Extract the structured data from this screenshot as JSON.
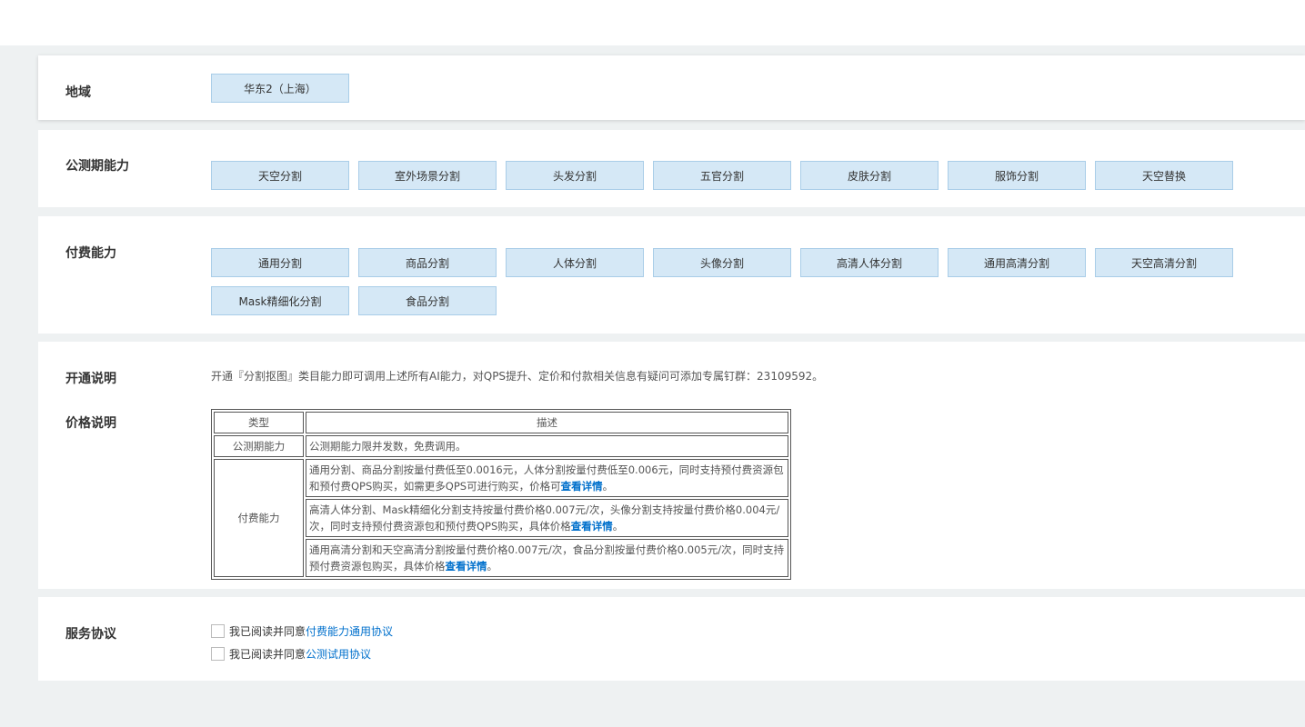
{
  "region": {
    "label": "地域",
    "options": [
      "华东2（上海）"
    ]
  },
  "beta": {
    "label": "公测期能力",
    "options": [
      "天空分割",
      "室外场景分割",
      "头发分割",
      "五官分割",
      "皮肤分割",
      "服饰分割",
      "天空替换"
    ]
  },
  "paid": {
    "label": "付费能力",
    "options": [
      "通用分割",
      "商品分割",
      "人体分割",
      "头像分割",
      "高清人体分割",
      "通用高清分割",
      "天空高清分割",
      "Mask精细化分割",
      "食品分割"
    ]
  },
  "activation": {
    "label": "开通说明",
    "text": "开通『分割抠图』类目能力即可调用上述所有AI能力，对QPS提升、定价和付款相关信息有疑问可添加专属钉群：23109592。"
  },
  "pricing": {
    "label": "价格说明",
    "headers": [
      "类型",
      "描述"
    ],
    "beta_type": "公测期能力",
    "beta_desc": "公测期能力限并发数，免费调用。",
    "paid_type": "付费能力",
    "paid_rows": [
      {
        "text": "通用分割、商品分割按量付费低至0.0016元，人体分割按量付费低至0.006元，同时支持预付费资源包和预付费QPS购买，如需更多QPS可进行购买，价格可",
        "link": "查看详情",
        "tail": "。"
      },
      {
        "text": "高清人体分割、Mask精细化分割支持按量付费价格0.007元/次，头像分割支持按量付费价格0.004元/次，同时支持预付费资源包和预付费QPS购买，具体价格",
        "link": "查看详情",
        "tail": "。"
      },
      {
        "text": "通用高清分割和天空高清分割按量付费价格0.007元/次，食品分割按量付费价格0.005元/次，同时支持预付费资源包购买，具体价格",
        "link": "查看详情",
        "tail": "。"
      }
    ]
  },
  "agreement": {
    "label": "服务协议",
    "items": [
      {
        "prefix": "我已阅读并同意",
        "link": "付费能力通用协议"
      },
      {
        "prefix": "我已阅读并同意",
        "link": "公测试用协议"
      }
    ]
  },
  "colors": {
    "chip_bg": "#d5e8f6",
    "chip_border": "#a9cde8",
    "link": "#0070cc",
    "page_bg": "#eef1f2"
  }
}
